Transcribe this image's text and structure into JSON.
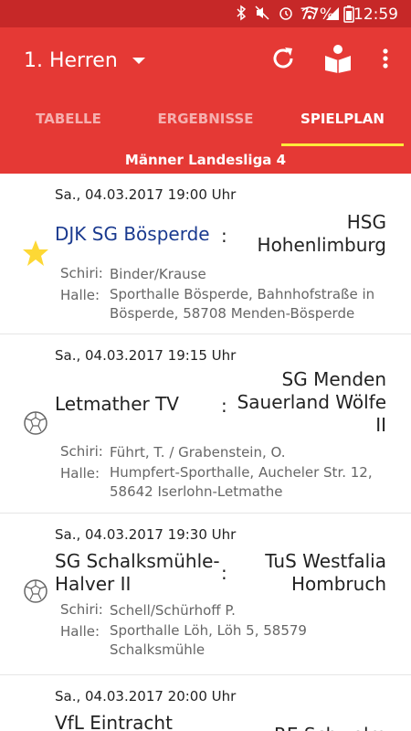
{
  "status": {
    "battery": "77%",
    "time": "12:59"
  },
  "appbar": {
    "team": "1. Herren"
  },
  "tabs": [
    "TABELLE",
    "ERGEBNISSE",
    "SPIELPLAN"
  ],
  "league": "Männer Landesliga 4",
  "labels": {
    "schiri": "Schiri:",
    "halle": "Halle:"
  },
  "matches": [
    {
      "datetime": "Sa., 04.03.2017 19:00 Uhr",
      "home": "DJK SG Bösperde",
      "away": "HSG Hohenlimburg",
      "schiri": "Binder/Krause",
      "halle": "Sporthalle Bösperde, Bahnhofstraße in Bösperde, 58708 Menden-Bösperde",
      "marker": "star-icon"
    },
    {
      "datetime": "Sa., 04.03.2017 19:15 Uhr",
      "home": "Letmather TV",
      "away": "SG Menden Sauerland Wölfe II",
      "schiri": "Führt, T. / Grabenstein, O.",
      "halle": "Humpfert-Sporthalle, Aucheler Str. 12, 58642 Iserlohn-Letmathe",
      "marker": "ball-icon"
    },
    {
      "datetime": "Sa., 04.03.2017 19:30 Uhr",
      "home": "SG Schalksmühle-Halver II",
      "away": "TuS Westfalia Hombruch",
      "schiri": "Schell/Schürhoff P.",
      "halle": "Sporthalle Löh, Löh 5, 58579 Schalksmühle",
      "marker": "ball-icon"
    },
    {
      "datetime": "Sa., 04.03.2017 20:00 Uhr",
      "home": "VfL Eintracht",
      "away": "RE Schwelm",
      "schiri": "",
      "halle": "",
      "marker": ""
    }
  ]
}
